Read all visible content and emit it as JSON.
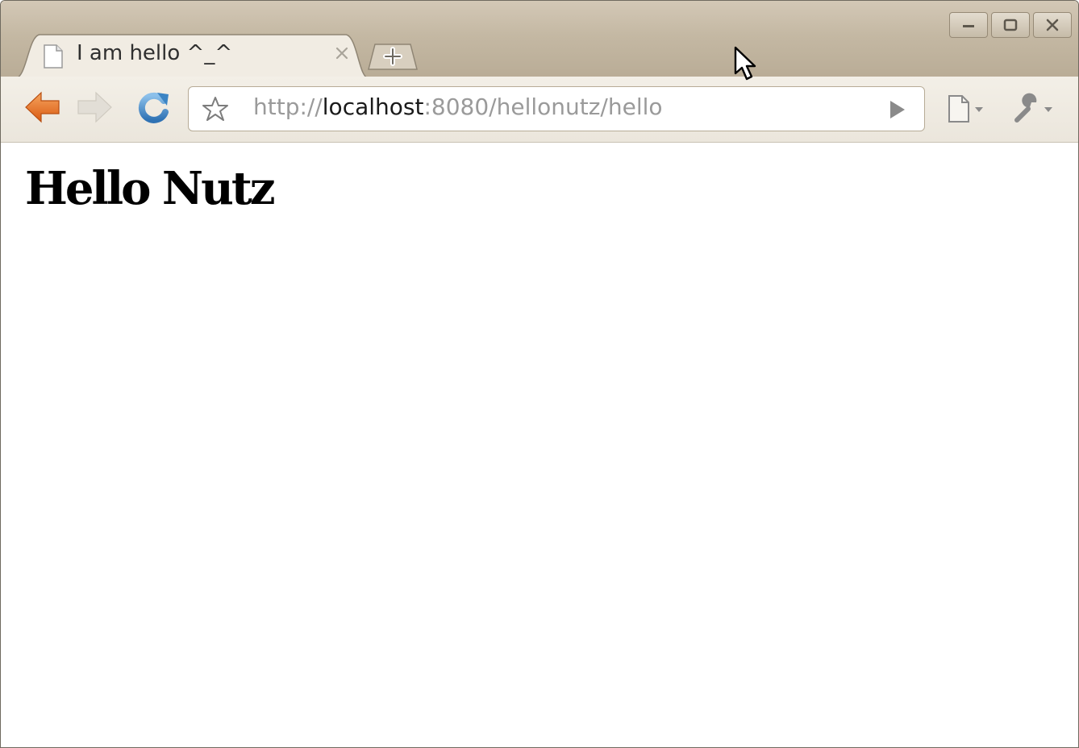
{
  "tab": {
    "title": "I am hello ^_^"
  },
  "address_bar": {
    "scheme": "http://",
    "host": "localhost",
    "rest": ":8080/hellonutz/hello"
  },
  "page": {
    "heading": "Hello Nutz"
  },
  "icons": {
    "back": "back-arrow-icon",
    "forward": "forward-arrow-icon",
    "reload": "reload-icon",
    "bookmark": "star-icon",
    "go": "go-arrow-icon",
    "page_menu": "page-menu-icon",
    "wrench_menu": "wrench-icon",
    "new_tab": "new-tab-plus-icon",
    "close_tab": "close-icon",
    "favicon": "document-icon",
    "minimize": "minimize-icon",
    "maximize": "maximize-icon",
    "close_window": "close-window-icon",
    "cursor": "mouse-pointer-icon"
  },
  "colors": {
    "titlebar": "#c4b8a3",
    "toolbar": "#f0ece3",
    "back_arrow": "#e8722a",
    "reload": "#3b84c4",
    "url_dim": "#9a9a9a",
    "url_host": "#1a1a1a"
  }
}
